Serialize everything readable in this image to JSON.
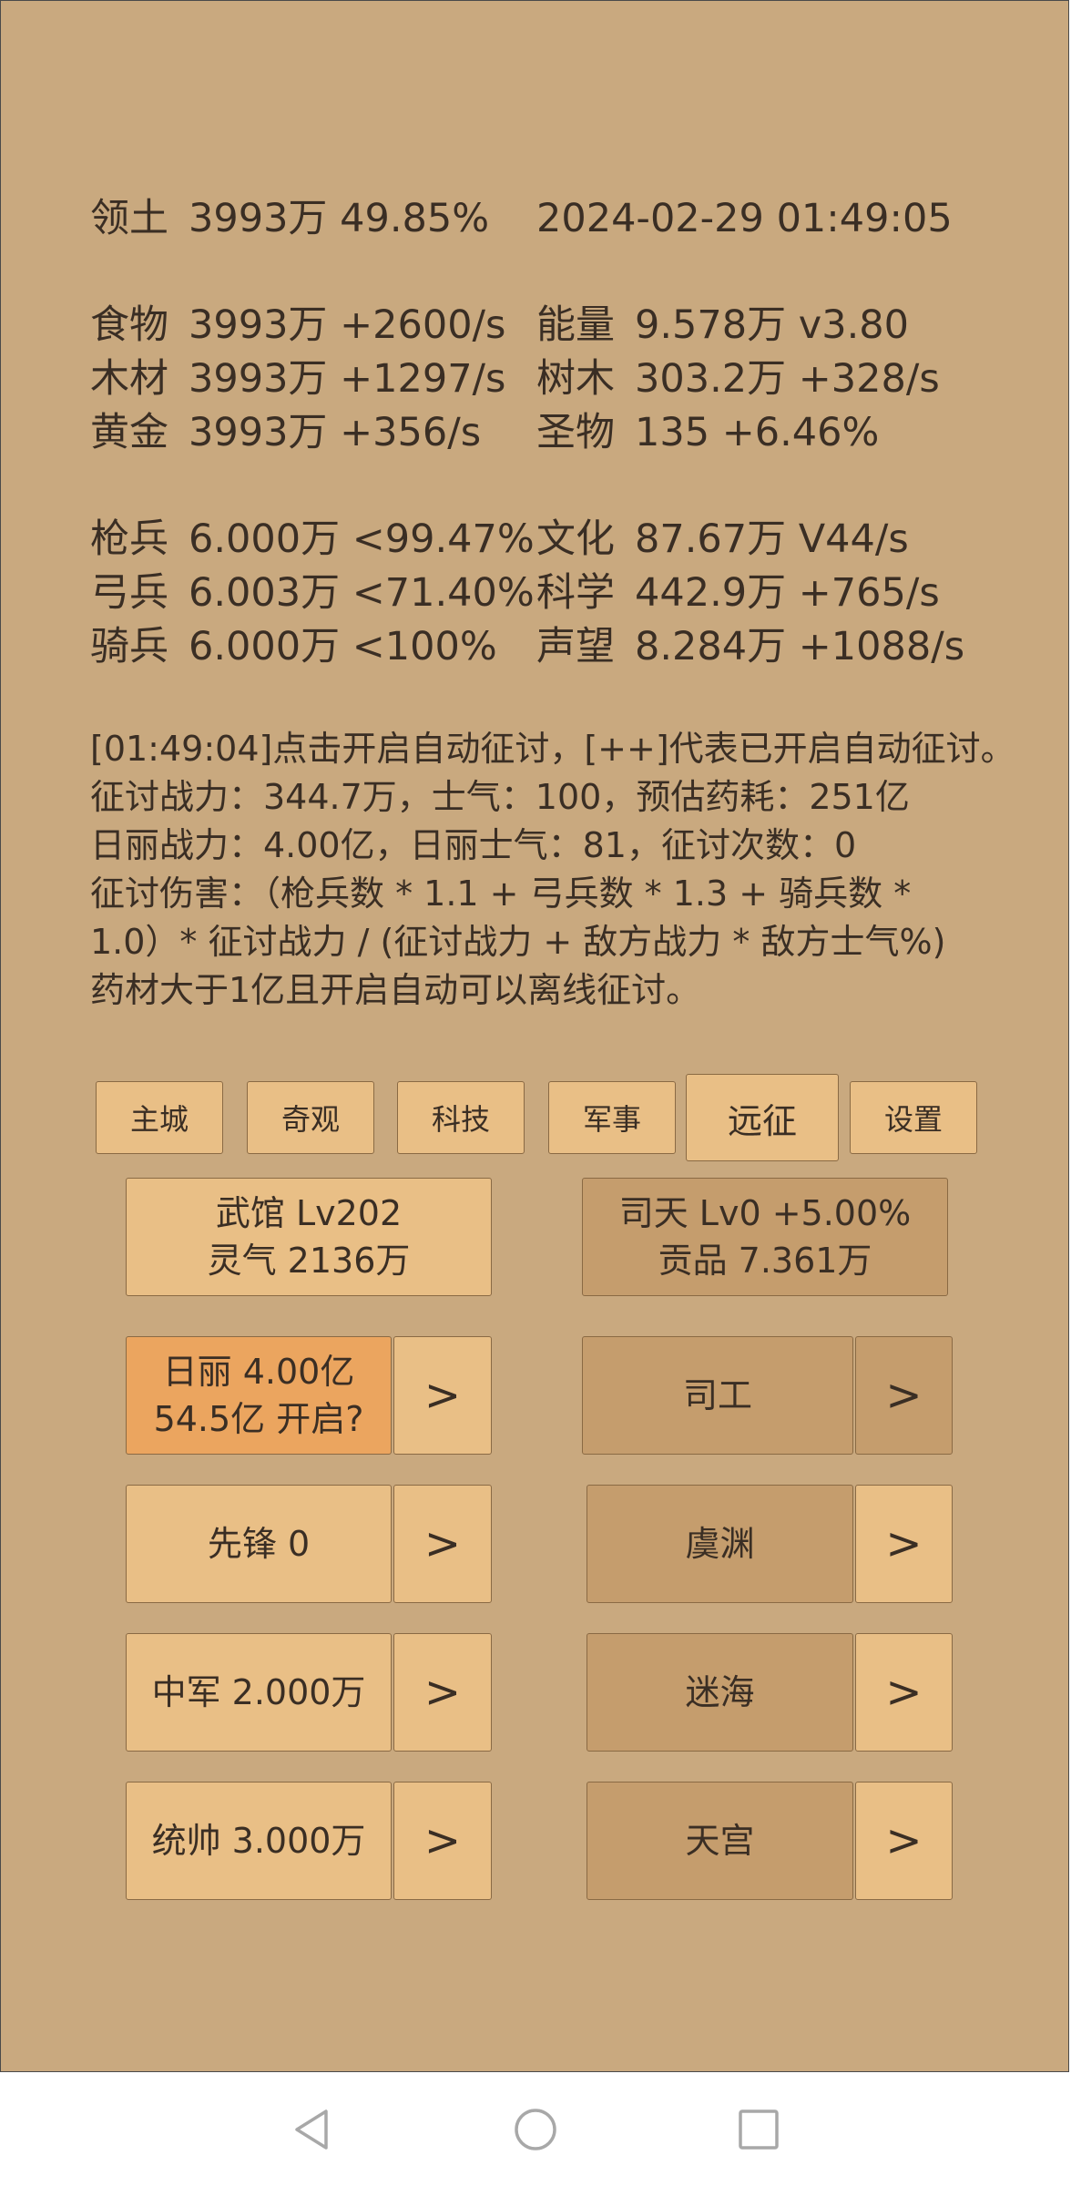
{
  "header": {
    "territory_label": "领土",
    "territory_value": "3993万  49.85%",
    "datetime": "2024-02-29 01:49:05"
  },
  "resources": [
    {
      "label": "食物",
      "value": "3993万 +2600/s"
    },
    {
      "label": "木材",
      "value": "3993万 +1297/s"
    },
    {
      "label": "黄金",
      "value": "3993万 +356/s"
    },
    {
      "label": "能量",
      "value": "9.578万  v3.80"
    },
    {
      "label": "树木",
      "value": "303.2万 +328/s"
    },
    {
      "label": "圣物",
      "value": "135 +6.46%"
    }
  ],
  "units": [
    {
      "label": "枪兵",
      "value": "6.000万 <99.47%"
    },
    {
      "label": "弓兵",
      "value": "6.003万 <71.40%"
    },
    {
      "label": "骑兵",
      "value": "6.000万 <100%"
    },
    {
      "label": "文化",
      "value": "87.67万 V44/s"
    },
    {
      "label": "科学",
      "value": "442.9万 +765/s"
    },
    {
      "label": "声望",
      "value": "8.284万 +1088/s"
    }
  ],
  "info_lines": [
    "[01:49:04]点击开启自动征讨，[++]代表已开启自动征讨。",
    "征讨战力：344.7万，士气：100，预估药耗：251亿",
    "日丽战力：4.00亿，日丽士气：81，征讨次数：0",
    "征讨伤害：（枪兵数 * 1.1 + 弓兵数 * 1.3 + 骑兵数 *",
    "1.0）* 征讨战力 / (征讨战力 + 敌方战力 * 敌方士气%)",
    "药材大于1亿且开启自动可以离线征讨。"
  ],
  "tabs": [
    "主城",
    "奇观",
    "科技",
    "军事",
    "远征",
    "设置"
  ],
  "wuguan": {
    "line1": "武馆 Lv202",
    "line2": "灵气 2136万"
  },
  "sitian": {
    "line1": "司天 Lv0 +5.00%",
    "line2": "贡品 7.361万"
  },
  "left_buttons": [
    {
      "line1": "日丽  4.00亿",
      "line2": "54.5亿 开启?"
    },
    {
      "label": "先锋  0"
    },
    {
      "label": "中军  2.000万"
    },
    {
      "label": "统帅  3.000万"
    }
  ],
  "right_buttons": [
    "司工",
    "虞渊",
    "迷海",
    "天宫"
  ],
  "arrow": ">",
  "colors": {
    "background": "#c9a97f",
    "button": "#e9bf86",
    "button_dark": "#c59d6d",
    "button_hot": "#eba55f"
  },
  "navbar": {
    "icons": [
      "back-icon",
      "home-icon",
      "recents-icon"
    ]
  }
}
